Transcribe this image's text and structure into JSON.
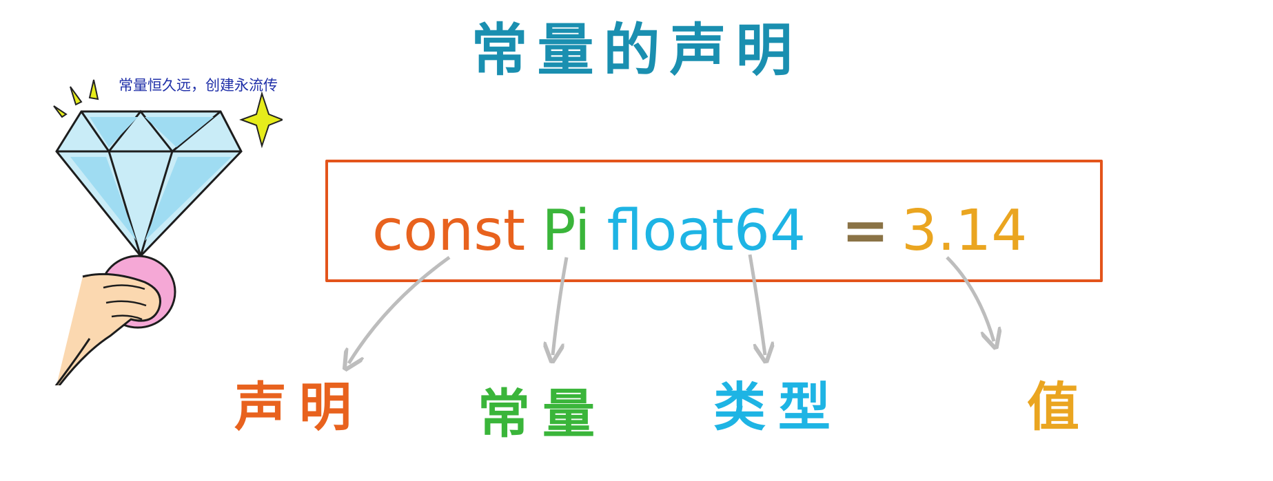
{
  "title": "常量的声明",
  "slogan": "常量恒久远，创建永流传",
  "code": {
    "keyword": "const",
    "name": "Pi",
    "type": "float64",
    "operator": "=",
    "value": "3.14"
  },
  "labels": {
    "declaration": "声明",
    "constant": "常量",
    "type": "类型",
    "value": "值"
  },
  "colors": {
    "title": "#1a8fb0",
    "keyword": "#e8621e",
    "name": "#3ab53a",
    "type": "#1eb4e4",
    "operator": "#8a7346",
    "value": "#eaa520",
    "box": "#e3541b",
    "arrow": "#bdbdbd"
  },
  "illustration": {
    "icons": [
      "diamond-icon",
      "hand-icon",
      "sparkle-icon"
    ]
  }
}
